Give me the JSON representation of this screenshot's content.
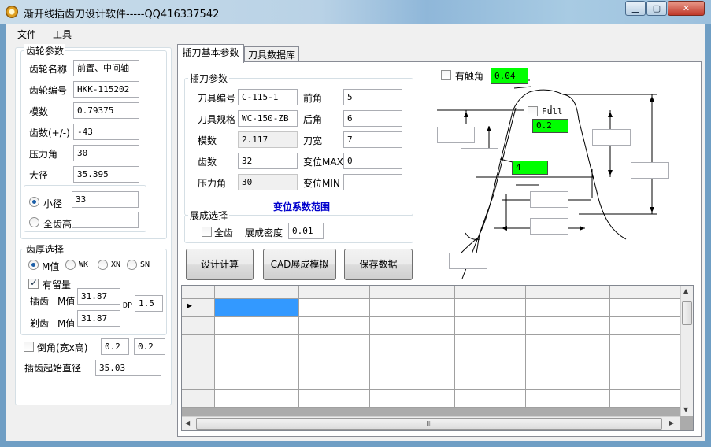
{
  "window": {
    "title": "渐开线插齿刀设计软件-----QQ416337542",
    "minimize_icon": "minimize-icon",
    "maximize_icon": "maximize-icon",
    "close_icon": "close-icon"
  },
  "menu": {
    "file": "文件",
    "tools": "工具"
  },
  "gear_params": {
    "title": "齿轮参数",
    "name_label": "齿轮名称",
    "name_value": "前置、中间轴",
    "code_label": "齿轮编号",
    "code_value": "HKK-115202",
    "module_label": "模数",
    "module_value": "0.79375",
    "teeth_label": "齿数(+/-)",
    "teeth_value": "-43",
    "pressure_label": "压力角",
    "pressure_value": "30",
    "major_label": "大径",
    "major_value": "35.395",
    "minor_label": "小径",
    "minor_value": "33",
    "full_depth_label": "全齿高",
    "full_depth_value": ""
  },
  "thickness": {
    "title": "齿厚选择",
    "m_option": "M值",
    "wk_option": "WK",
    "xn_option": "XN",
    "sn_option": "SN",
    "allowance_label": "有留量",
    "shaping_label": "插齿",
    "shaping_m_label": "M值",
    "shaping_value": "31.87",
    "shaving_label": "剃齿",
    "shaving_m_label": "M值",
    "shaving_value": "31.87",
    "dp_label": "DP",
    "dp_value": "1.5"
  },
  "chamfer": {
    "label": "倒角(宽x高)",
    "width": "0.2",
    "height": "0.2"
  },
  "start_dia": {
    "label": "插齿起始直径",
    "value": "35.03"
  },
  "tabs": {
    "basic": "插刀基本参数",
    "db": "刀具数据库"
  },
  "cutter": {
    "title": "插刀参数",
    "code_label": "刀具编号",
    "code_value": "C-115-1",
    "spec_label": "刀具规格",
    "spec_value": "WC-150-ZB",
    "module_label": "模数",
    "module_value": "2.117",
    "teeth_label": "齿数",
    "teeth_value": "32",
    "pressure_label": "压力角",
    "pressure_value": "30",
    "rake_label": "前角",
    "rake_value": "5",
    "clear_label": "后角",
    "clear_value": "6",
    "width_label": "刀宽",
    "width_value": "7",
    "shift_max_label": "变位MAX",
    "shift_max_value": "0",
    "shift_min_label": "变位MIN",
    "shift_min_value": "",
    "range_link": "变位系数范围"
  },
  "generation": {
    "title": "展成选择",
    "all_teeth_label": "全齿",
    "density_label": "展成密度",
    "density_value": "0.01"
  },
  "buttons": {
    "calc": "设计计算",
    "cad": "CAD展成模拟",
    "save": "保存数据"
  },
  "diagram": {
    "contact_label": "有触角",
    "contact_value": "0.04",
    "full_label": "Full",
    "full_value": "0.2",
    "mid_value": "4"
  },
  "colors": {
    "green_field": "#00ff00",
    "range_link": "#0000cc",
    "selected_cell": "#3399ff"
  },
  "scrollbar": {
    "hthumb": "III"
  }
}
